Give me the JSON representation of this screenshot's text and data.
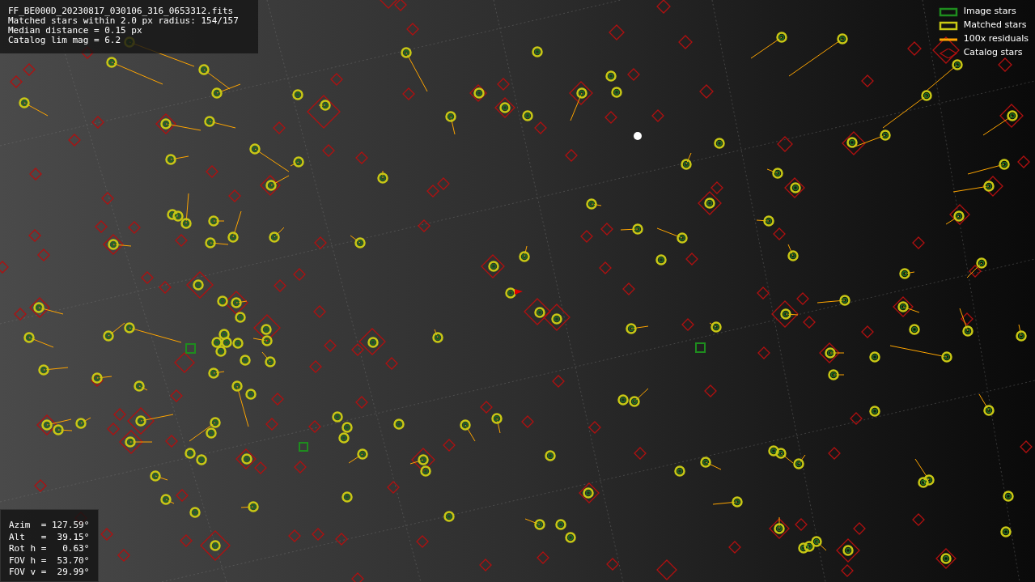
{
  "info": {
    "lines": [
      "FF_BE000D_20230817_030106_316_0653312.fits",
      "Matched stars within 2.0 px radius: 154/157",
      "Median distance = 0.15 px",
      "Catalog lim mag = 6.2"
    ]
  },
  "legend": [
    {
      "kind": "box",
      "label": "Image stars",
      "color": "#1e8c1e"
    },
    {
      "kind": "box",
      "label": "Matched stars",
      "color": "#c8c814"
    },
    {
      "kind": "line",
      "label": "100x residuals",
      "color": "#ffa500"
    },
    {
      "kind": "diamond",
      "label": "Catalog stars",
      "color": "#b01010"
    }
  ],
  "pointing": {
    "lines": [
      "Azim  = 127.59°",
      "Alt   =  39.15°",
      "Rot h =   0.63°",
      "FOV h =  53.70°",
      "FOV v =  29.99°"
    ]
  }
}
